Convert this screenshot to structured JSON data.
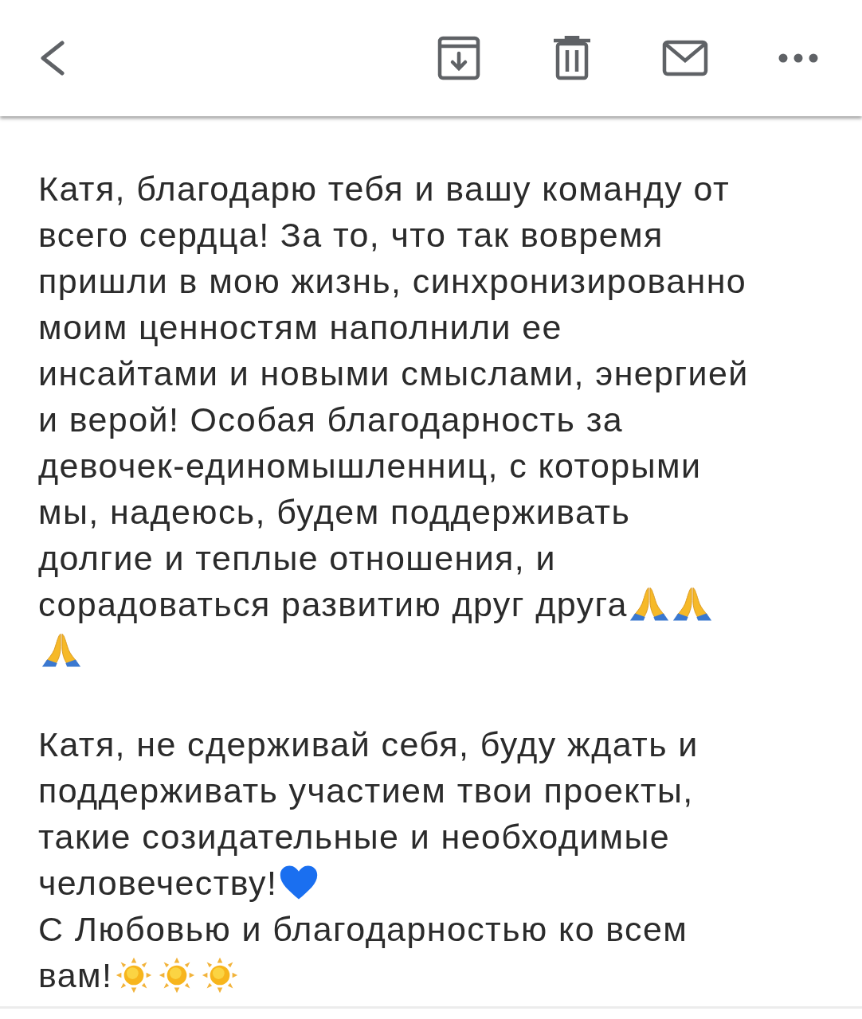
{
  "toolbar": {
    "actions": [
      {
        "kind": "back"
      },
      {
        "kind": "archive"
      },
      {
        "kind": "trash"
      },
      {
        "kind": "mail"
      },
      {
        "kind": "more"
      }
    ]
  },
  "message": {
    "paragraphs": [
      {
        "lines": [
          {
            "text": "Катя, благодарю тебя и вашу команду от"
          },
          {
            "text": "всего сердца! За то, что так вовремя"
          },
          {
            "text": "пришли в мою жизнь, синхронизированно"
          },
          {
            "text": "моим ценностям наполнили ее"
          },
          {
            "text": "инсайтами и новыми смыслами, энергией"
          },
          {
            "text": "и верой! Особая благодарность за"
          },
          {
            "text": "девочек-единомышленниц, с которыми"
          },
          {
            "text": "мы, надеюсь, будем поддерживать"
          },
          {
            "text": "долгие и теплые отношения, и"
          },
          {
            "text": "сорадоваться развитию друг друга",
            "emojis": [
              {
                "kind": "praying-hands"
              },
              {
                "kind": "praying-hands"
              }
            ]
          },
          {
            "emojis": [
              {
                "kind": "praying-hands"
              }
            ]
          }
        ]
      },
      {
        "lines": [
          {
            "text": "Катя, не сдерживай себя, буду ждать и"
          },
          {
            "text": "поддерживать участием твои проекты,"
          },
          {
            "text": "такие созидательные и необходимые"
          },
          {
            "text": "человечеству!",
            "emojis": [
              {
                "kind": "heart"
              }
            ]
          },
          {
            "text": "С Любовью и благодарностью ко всем"
          },
          {
            "text": "вам!",
            "emojis": [
              {
                "kind": "sun"
              },
              {
                "kind": "sun"
              },
              {
                "kind": "sun"
              }
            ]
          }
        ]
      }
    ]
  }
}
